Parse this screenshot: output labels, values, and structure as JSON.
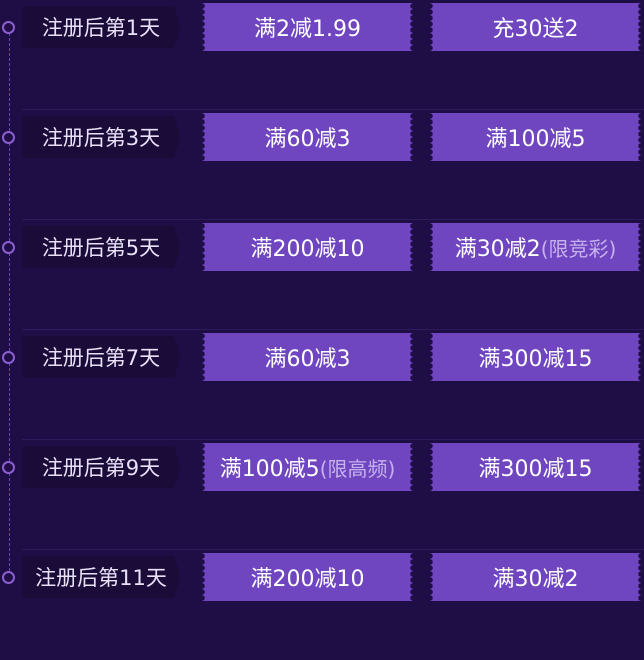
{
  "rows": [
    {
      "day": "注册后第1天",
      "left": {
        "text": "满2减1.99",
        "note": ""
      },
      "right": {
        "text": "充30送2",
        "note": ""
      }
    },
    {
      "day": "注册后第3天",
      "left": {
        "text": "满60减3",
        "note": ""
      },
      "right": {
        "text": "满100减5",
        "note": ""
      }
    },
    {
      "day": "注册后第5天",
      "left": {
        "text": "满200减10",
        "note": ""
      },
      "right": {
        "text": "满30减2",
        "note": "(限竞彩)"
      }
    },
    {
      "day": "注册后第7天",
      "left": {
        "text": "满60减3",
        "note": ""
      },
      "right": {
        "text": "满300减15",
        "note": ""
      }
    },
    {
      "day": "注册后第9天",
      "left": {
        "text": "满100减5",
        "note": "(限高频)"
      },
      "right": {
        "text": "满300减15",
        "note": ""
      }
    },
    {
      "day": "注册后第11天",
      "left": {
        "text": "满200减10",
        "note": ""
      },
      "right": {
        "text": "满30减2",
        "note": ""
      }
    }
  ],
  "colors": {
    "background": "#1f0d45",
    "coupon": "#6f45c0",
    "label_bg": "#1a0b38",
    "timeline": "#8a5fd0"
  }
}
